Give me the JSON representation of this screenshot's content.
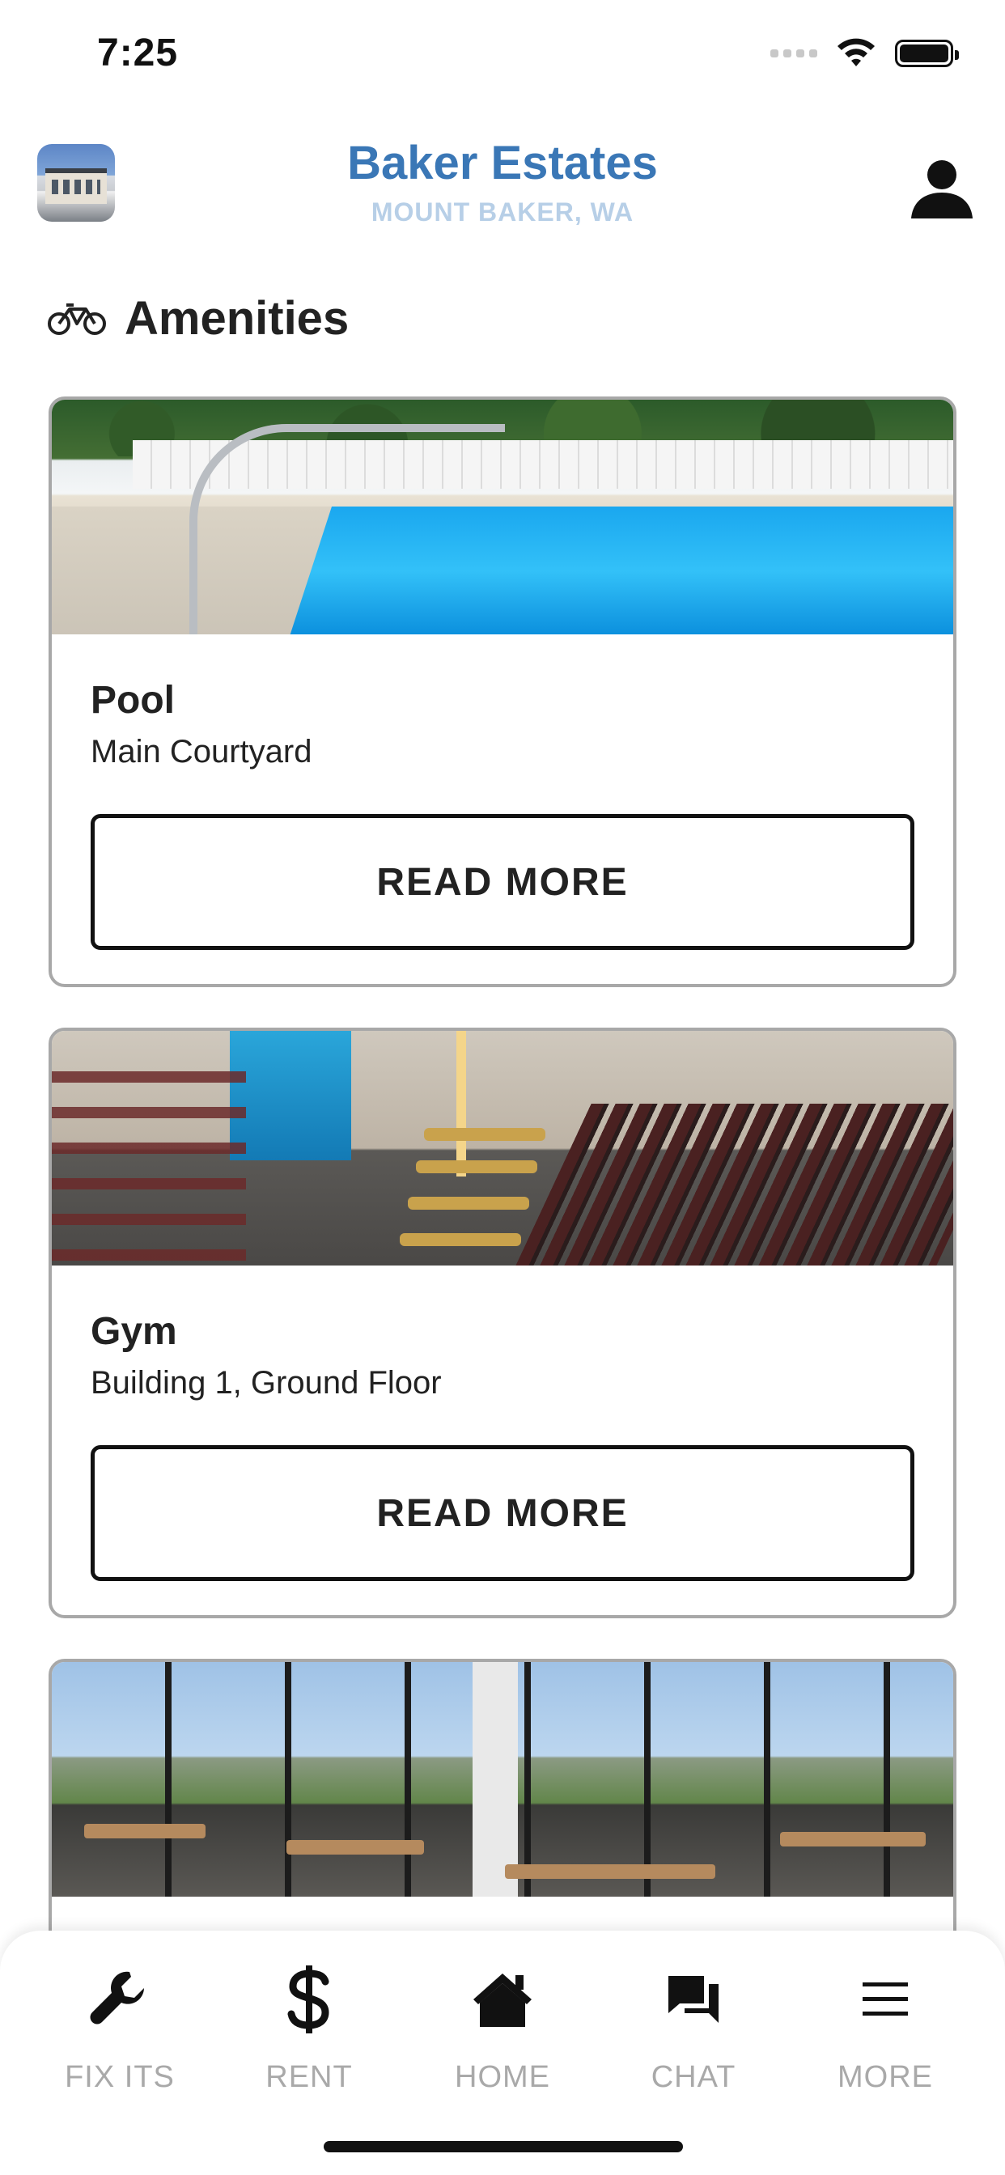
{
  "status_bar": {
    "time": "7:25"
  },
  "header": {
    "title": "Baker Estates",
    "subtitle": "MOUNT BAKER, WA"
  },
  "section": {
    "title": "Amenities",
    "icon": "bicycle-icon"
  },
  "amenities": [
    {
      "title": "Pool",
      "location": "Main Courtyard",
      "button": "READ MORE"
    },
    {
      "title": "Gym",
      "location": "Building 1, Ground Floor",
      "button": "READ MORE"
    },
    {
      "title": "",
      "location": "",
      "button": ""
    }
  ],
  "bottom_nav": [
    {
      "label": "FIX ITS",
      "icon": "wrench-icon"
    },
    {
      "label": "RENT",
      "icon": "dollar-icon"
    },
    {
      "label": "HOME",
      "icon": "home-icon"
    },
    {
      "label": "CHAT",
      "icon": "chat-icon"
    },
    {
      "label": "MORE",
      "icon": "menu-icon"
    }
  ],
  "colors": {
    "accent": "#3a77b6",
    "subtitle": "#b7cfe7",
    "inactive_label": "#a9a9a9"
  }
}
